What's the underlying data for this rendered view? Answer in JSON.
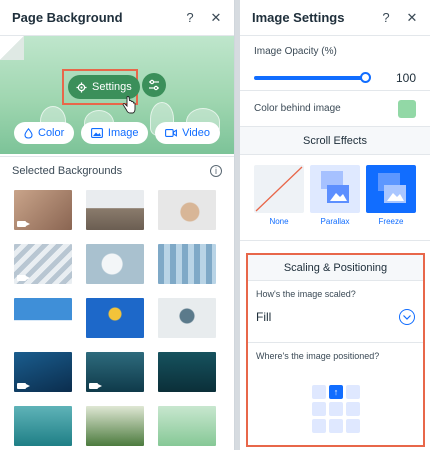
{
  "left_panel": {
    "title": "Page Background",
    "help_icon": "?",
    "close_icon": "✕",
    "settings_label": "Settings",
    "buttons": {
      "color": "Color",
      "image": "Image",
      "video": "Video"
    },
    "selected_backgrounds_label": "Selected Backgrounds",
    "info_icon": "i"
  },
  "right_panel": {
    "title": "Image Settings",
    "help_icon": "?",
    "close_icon": "✕",
    "opacity_label": "Image Opacity (%)",
    "opacity_value": "100",
    "opacity_fraction": 1.0,
    "color_behind_label": "Color behind image",
    "color_behind_swatch": "#92d8a6",
    "scroll_effects_title": "Scroll Effects",
    "effects": [
      {
        "label": "None"
      },
      {
        "label": "Parallax"
      },
      {
        "label": "Freeze"
      }
    ],
    "selected_effect": "Freeze",
    "scaling_title": "Scaling & Positioning",
    "scale_question": "How's the image scaled?",
    "scale_value": "Fill",
    "position_question": "Where's the image positioned?",
    "selected_position": "top-center"
  },
  "colors": {
    "accent": "#116dff",
    "highlight_border": "#e8674a",
    "settings_green": "#3b8f5a"
  }
}
